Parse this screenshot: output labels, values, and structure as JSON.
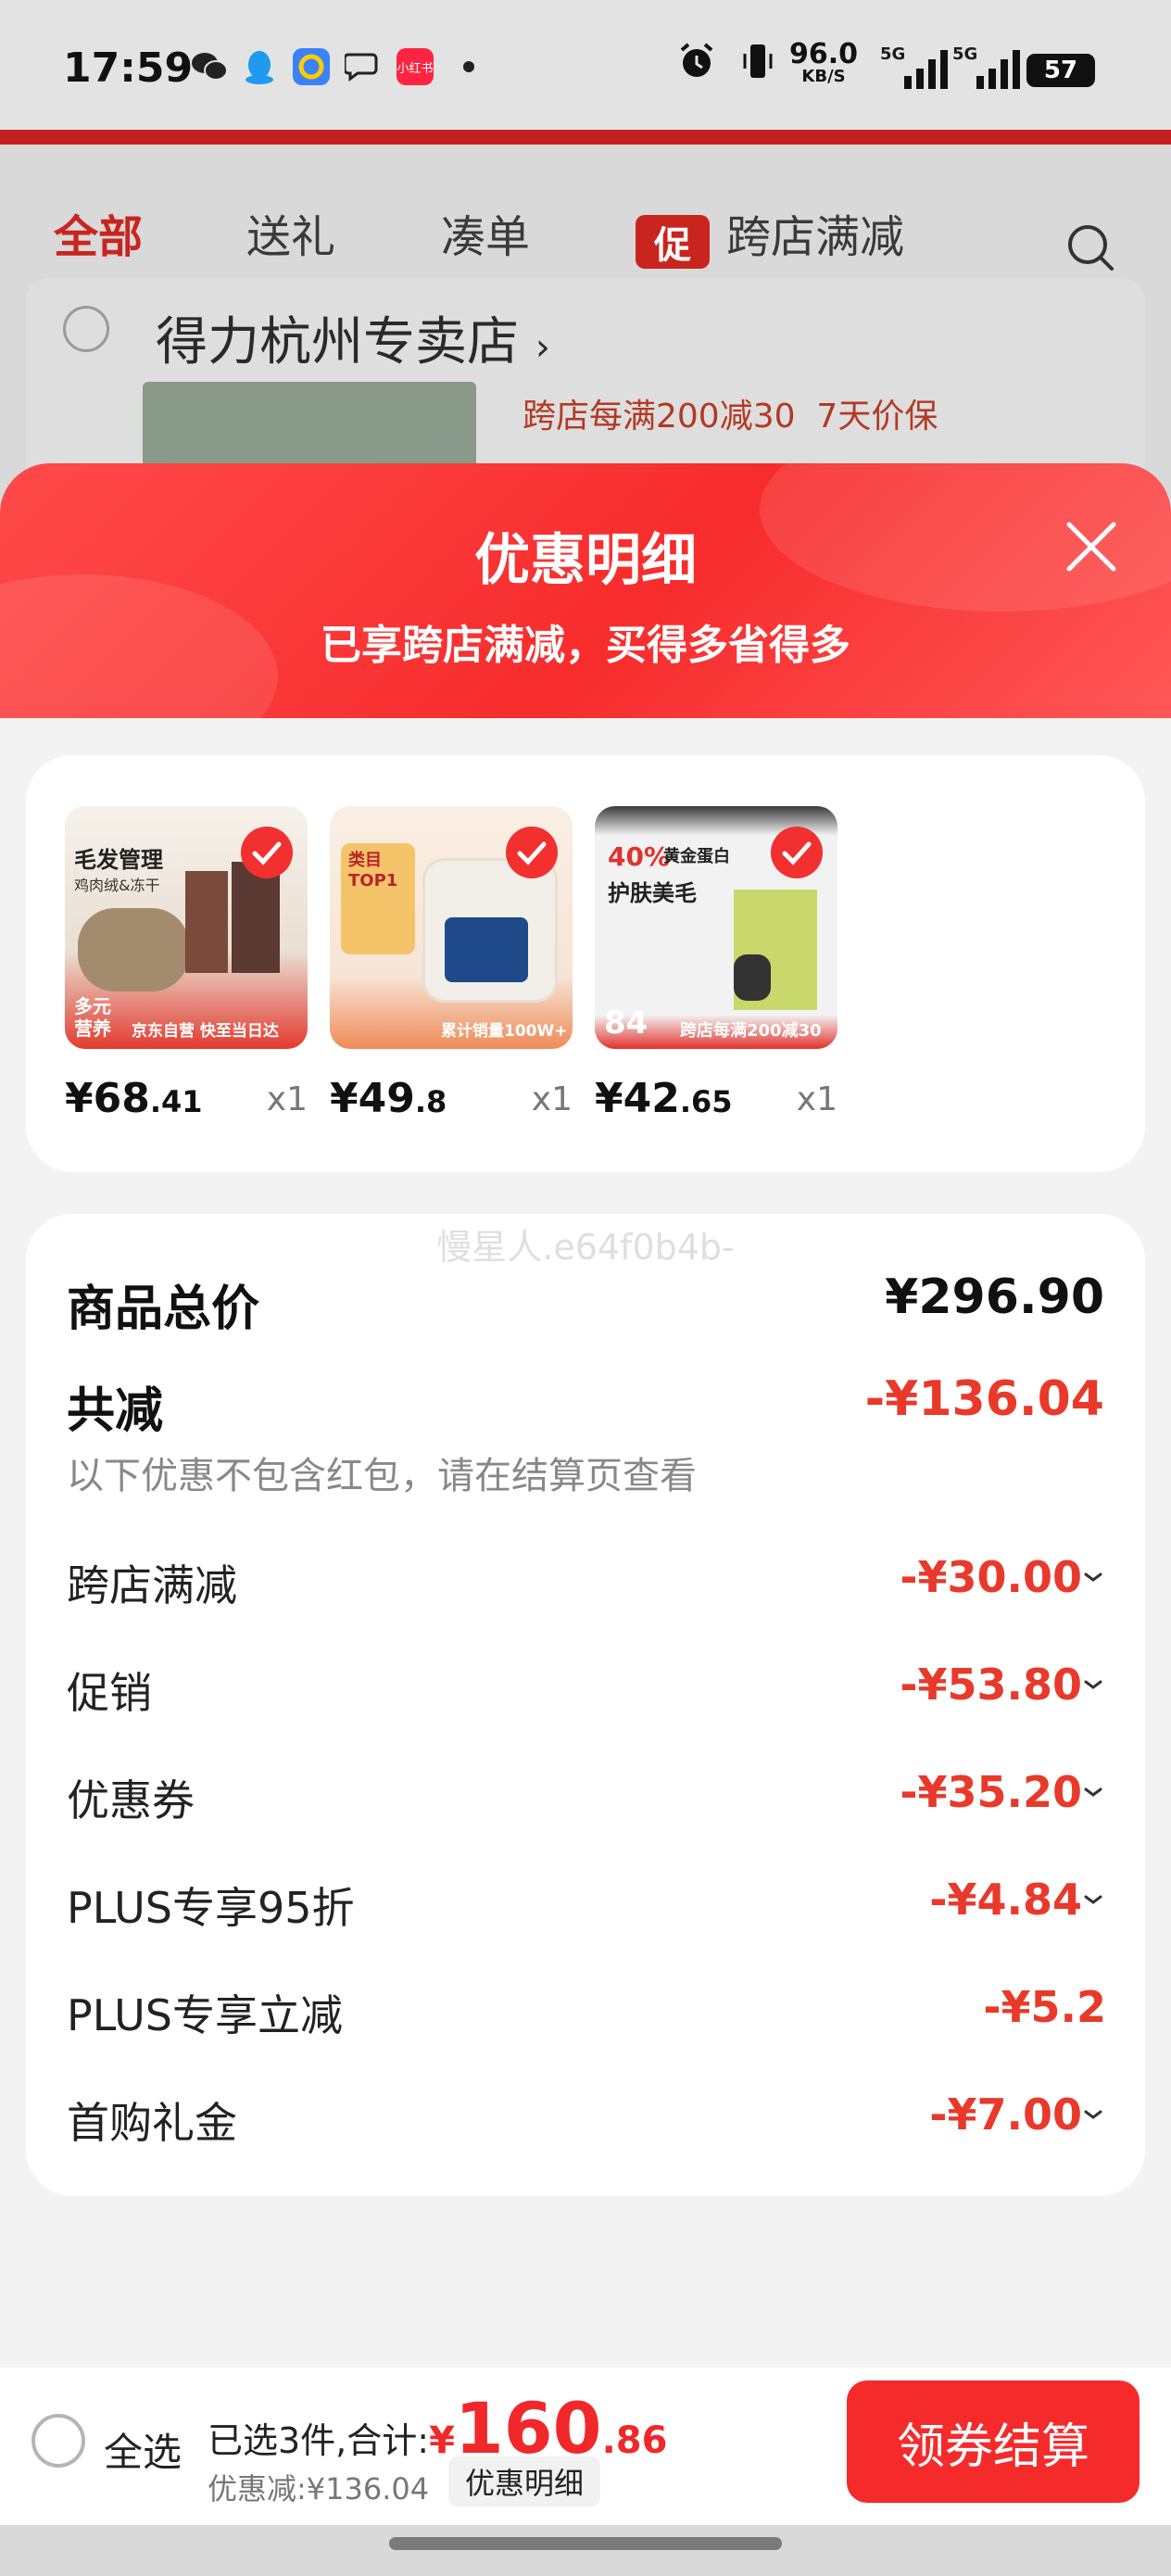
{
  "status_bar": {
    "time": "17:59",
    "apps": [
      "wechat-icon",
      "qq-icon",
      "browser-icon",
      "chat-bubble-icon",
      "xiaohongshu-icon"
    ],
    "xiaohongshu_label": "小红书",
    "net_speed": "96.0",
    "net_unit": "KB/S",
    "signal1": "5G",
    "signal2": "5G",
    "battery": "57"
  },
  "background": {
    "tabs": [
      "全部",
      "送礼",
      "凑单"
    ],
    "promo_badge": "促",
    "promo_tab": "跨店满减",
    "store_name": "得力杭州专卖店",
    "store_arrow": "›",
    "store_promo": "跨店每满200减30",
    "store_protect": "7天价保"
  },
  "sheet": {
    "title": "优惠明细",
    "subtitle": "已享跨店满减，买得多省得多",
    "products": [
      {
        "price_int": "¥68",
        "price_dec": ".41",
        "qty": "x1",
        "img_texts": [
          "毛发管理",
          "鸡肉绒&冻干",
          "多元",
          "营养",
          "京东自营 快至当日达"
        ]
      },
      {
        "price_int": "¥49",
        "price_dec": ".8",
        "qty": "x1",
        "img_texts": [
          "类目",
          "TOP1",
          "累计销量100W+"
        ]
      },
      {
        "price_int": "¥42",
        "price_dec": ".65",
        "qty": "x1",
        "img_texts": [
          "40%",
          "黄金蛋白",
          "护肤美毛",
          "84",
          "跨店每满200减30"
        ]
      }
    ],
    "watermark": "慢星人.e64f0b4b-",
    "summary": {
      "total_label": "商品总价",
      "total_value": "¥296.90",
      "reduce_label": "共减",
      "reduce_value": "-¥136.04",
      "note": "以下优惠不包含红包，请在结算页查看",
      "rows": [
        {
          "label": "跨店满减",
          "value": "-¥30.00"
        },
        {
          "label": "促销",
          "value": "-¥53.80"
        },
        {
          "label": "优惠券",
          "value": "-¥35.20"
        },
        {
          "label": "PLUS专享95折",
          "value": "-¥4.84"
        },
        {
          "label": "PLUS专享立减",
          "value": "-¥5.2"
        },
        {
          "label": "首购礼金",
          "value": "-¥7.00"
        }
      ]
    }
  },
  "bottom_bar": {
    "select_all": "全选",
    "selected_text": "已选3件,合计:",
    "total_currency": "¥",
    "total_int": "160",
    "total_dec": ".86",
    "discount_text": "优惠减:¥136.04",
    "detail_button": "优惠明细",
    "checkout_button": "领券结算"
  },
  "colors": {
    "accent_red": "#f52a2a",
    "discount_red": "#e8392b",
    "header_gradient_start": "#ff4a4a"
  }
}
